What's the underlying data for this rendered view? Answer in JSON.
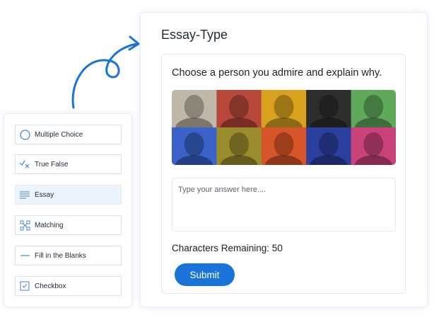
{
  "essay": {
    "title": "Essay-Type",
    "question": "Choose a person you admire and explain why.",
    "answer_placeholder": "Type your answer here....",
    "answer_value": "",
    "characters_remaining_label": "Characters Remaining: 50",
    "submit_label": "Submit",
    "portrait_tints": [
      "#bfb7a8",
      "#b8483a",
      "#d8a21f",
      "#2d2d2d",
      "#5fa95a",
      "#3a62c9",
      "#9b8d2e",
      "#d8552a",
      "#2b3f9e",
      "#c9437a"
    ]
  },
  "question_types": [
    {
      "label": "Multiple Choice",
      "icon": "circle-icon"
    },
    {
      "label": "True False",
      "icon": "check-cross-icon"
    },
    {
      "label": "Essay",
      "icon": "lines-icon",
      "active": true
    },
    {
      "label": "Matching",
      "icon": "matching-icon"
    },
    {
      "label": "Fill in the Blanks",
      "icon": "dash-icon"
    },
    {
      "label": "Checkbox",
      "icon": "checkbox-icon"
    }
  ],
  "colors": {
    "accent": "#1a73d8",
    "icon": "#3f86d6",
    "active_item_bg": "#eef4fb"
  }
}
